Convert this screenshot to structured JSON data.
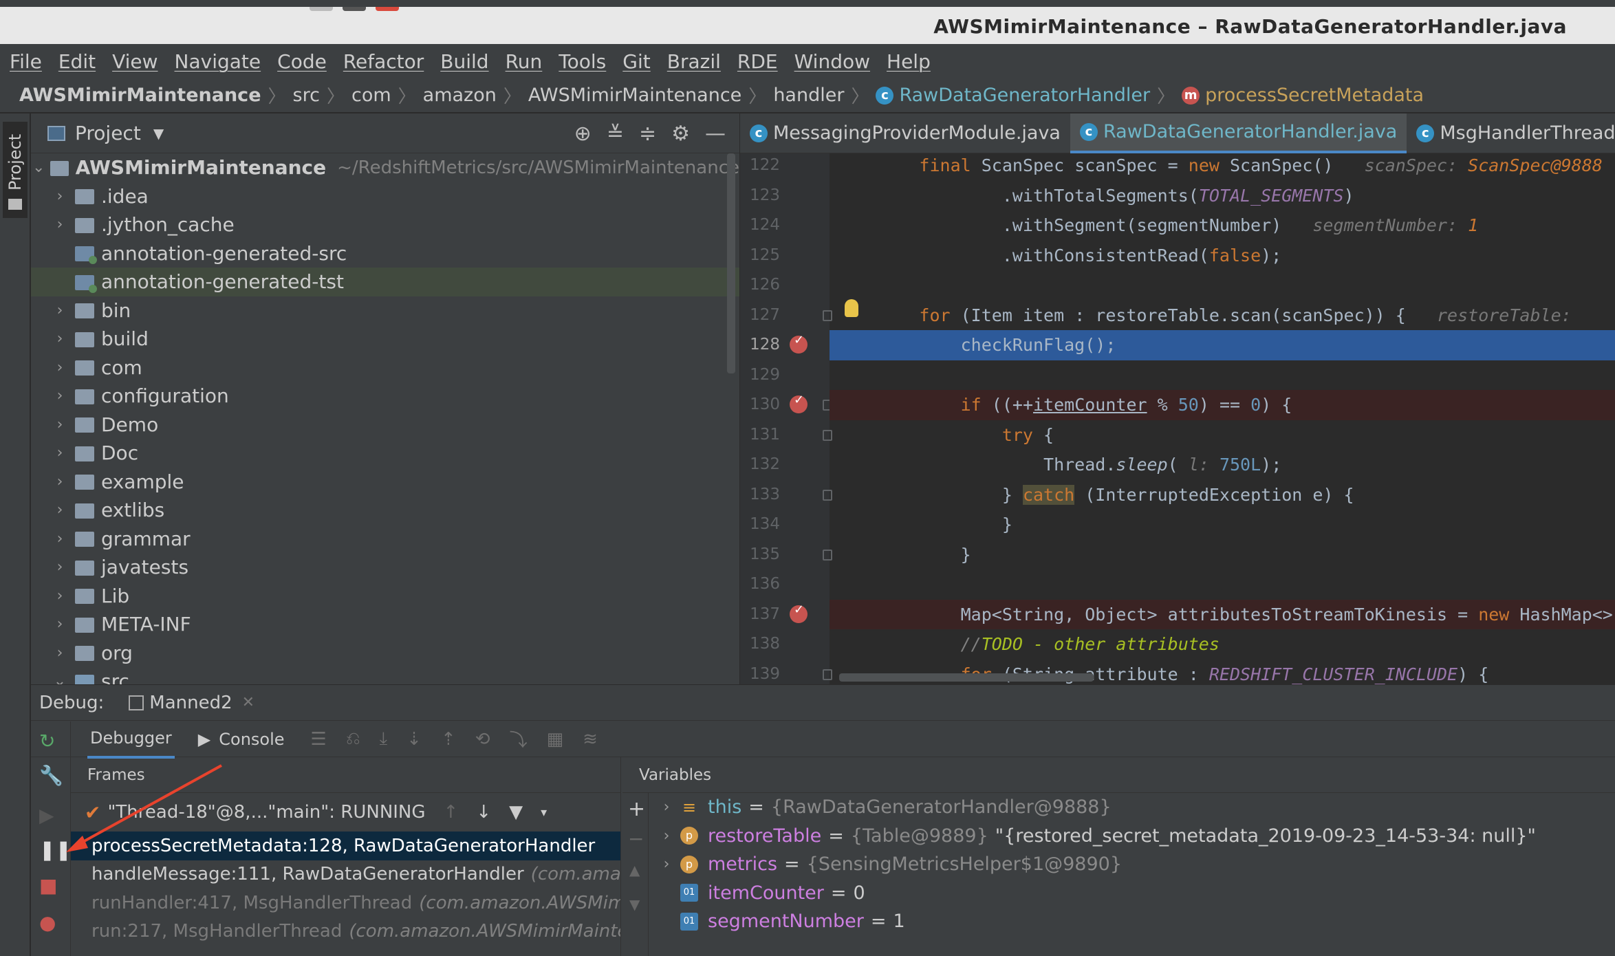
{
  "window": {
    "title": "AWSMimirMaintenance – RawDataGeneratorHandler.java"
  },
  "menu": [
    "File",
    "Edit",
    "View",
    "Navigate",
    "Code",
    "Refactor",
    "Build",
    "Run",
    "Tools",
    "Git",
    "Brazil",
    "RDE",
    "Window",
    "Help"
  ],
  "breadcrumb": {
    "items": [
      "AWSMimirMaintenance",
      "src",
      "com",
      "amazon",
      "AWSMimirMaintenance",
      "handler"
    ],
    "class_name": "RawDataGeneratorHandler",
    "method_name": "processSecretMetadata"
  },
  "left_strip": {
    "project_tab": "Project"
  },
  "project": {
    "title": "Project",
    "root": {
      "name": "AWSMimirMaintenance",
      "path": "~/RedshiftMetrics/src/AWSMimirMaintenance"
    },
    "items": [
      {
        "name": ".idea",
        "expandable": true
      },
      {
        "name": ".jython_cache",
        "expandable": true
      },
      {
        "name": "annotation-generated-src",
        "expandable": false
      },
      {
        "name": "annotation-generated-tst",
        "expandable": false,
        "selected": true
      },
      {
        "name": "bin",
        "expandable": true
      },
      {
        "name": "build",
        "expandable": true
      },
      {
        "name": "com",
        "expandable": true
      },
      {
        "name": "configuration",
        "expandable": true
      },
      {
        "name": "Demo",
        "expandable": true
      },
      {
        "name": "Doc",
        "expandable": true
      },
      {
        "name": "example",
        "expandable": true
      },
      {
        "name": "extlibs",
        "expandable": true
      },
      {
        "name": "grammar",
        "expandable": true
      },
      {
        "name": "javatests",
        "expandable": true
      },
      {
        "name": "Lib",
        "expandable": true
      },
      {
        "name": "META-INF",
        "expandable": true
      },
      {
        "name": "org",
        "expandable": true
      },
      {
        "name": "src",
        "expandable": true,
        "expanded": true
      }
    ]
  },
  "editor": {
    "tabs": [
      "MessagingProviderModule.java",
      "RawDataGeneratorHandler.java",
      "MsgHandlerThread.class"
    ],
    "active_tab": 1,
    "line_numbers": [
      "122",
      "123",
      "124",
      "125",
      "126",
      "127",
      "128",
      "129",
      "130",
      "131",
      "132",
      "133",
      "134",
      "135",
      "136",
      "137",
      "138",
      "139"
    ],
    "current_line": "128",
    "breakpoint_lines": [
      "128",
      "130",
      "137"
    ]
  },
  "debug": {
    "label": "Debug:",
    "session": "Manned2",
    "subtabs": [
      "Debugger",
      "Console"
    ],
    "frames_header": "Frames",
    "variables_header": "Variables",
    "thread": "\"Thread-18\"@8,...\"main\": RUNNING",
    "frames": [
      {
        "method": "processSecretMetadata:128, RawDataGeneratorHandler",
        "pkg": "",
        "selected": true,
        "dim": false
      },
      {
        "method": "handleMessage:111, RawDataGeneratorHandler",
        "pkg": "(com.amazon.AWSMimirMaintenance.handler)",
        "selected": false,
        "dim": false
      },
      {
        "method": "runHandler:417, MsgHandlerThread",
        "pkg": "(com.amazon.AWSMimirMaintenance)",
        "selected": false,
        "dim": true
      },
      {
        "method": "run:217, MsgHandlerThread",
        "pkg": "(com.amazon.AWSMimirMaintenance)",
        "selected": false,
        "dim": true
      }
    ],
    "variables": [
      {
        "name": "this",
        "eq": "=",
        "type": "{RawDataGeneratorHandler@9888}",
        "value": "",
        "icon": "this"
      },
      {
        "name": "restoreTable",
        "eq": "=",
        "type": "{Table@9889}",
        "value": "\"{restored_secret_metadata_2019-09-23_14-53-34: null}\"",
        "icon": "field"
      },
      {
        "name": "metrics",
        "eq": "=",
        "type": "{SensingMetricsHelper$1@9890}",
        "value": "",
        "icon": "field"
      },
      {
        "name": "itemCounter",
        "eq": "=",
        "type": "",
        "value": "0",
        "icon": "prim"
      },
      {
        "name": "segmentNumber",
        "eq": "=",
        "type": "",
        "value": "1",
        "icon": "prim"
      }
    ]
  },
  "colors": {
    "background": "#2b2b2b",
    "panel": "#3c3f41",
    "execution_line": "#2d5a9a",
    "breakpoint": "#c75450",
    "keyword": "#cc7832",
    "constant": "#9876aa",
    "annotation_arrow": "#e8432d"
  }
}
